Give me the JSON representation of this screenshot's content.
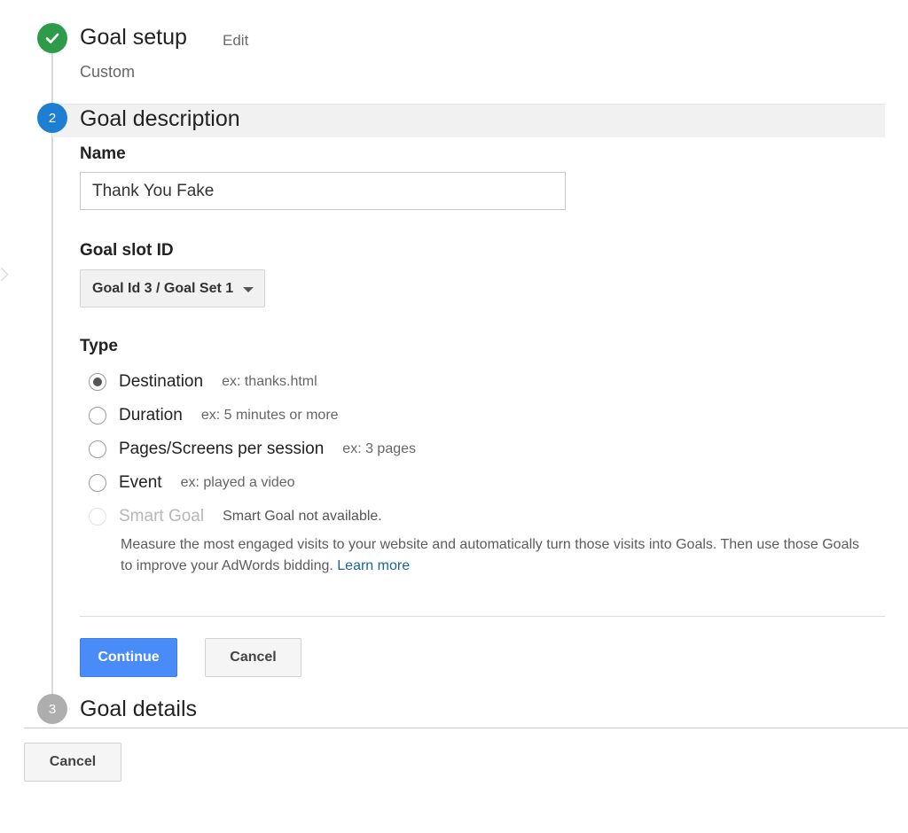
{
  "steps": {
    "setup": {
      "title": "Goal setup",
      "edit_label": "Edit",
      "summary": "Custom",
      "icon": "checkmark-icon"
    },
    "description": {
      "number": "2",
      "title": "Goal description"
    },
    "details": {
      "number": "3",
      "title": "Goal details"
    }
  },
  "form": {
    "name": {
      "label": "Name",
      "value": "Thank You Fake"
    },
    "slot": {
      "label": "Goal slot ID",
      "selected": "Goal Id 3 / Goal Set 1"
    },
    "type": {
      "label": "Type",
      "options": [
        {
          "label": "Destination",
          "example": "ex: thanks.html",
          "selected": true,
          "disabled": false
        },
        {
          "label": "Duration",
          "example": "ex: 5 minutes or more",
          "selected": false,
          "disabled": false
        },
        {
          "label": "Pages/Screens per session",
          "example": "ex: 3 pages",
          "selected": false,
          "disabled": false
        },
        {
          "label": "Event",
          "example": "ex: played a video",
          "selected": false,
          "disabled": false
        },
        {
          "label": "Smart Goal",
          "example": "Smart Goal not available.",
          "selected": false,
          "disabled": true
        }
      ],
      "smart_goal_description": "Measure the most engaged visits to your website and automatically turn those visits into Goals. Then use those Goals to improve your AdWords bidding.",
      "learn_more": "Learn more"
    }
  },
  "buttons": {
    "continue": "Continue",
    "cancel": "Cancel",
    "page_cancel": "Cancel"
  },
  "colors": {
    "complete": "#2e9b4a",
    "active": "#1d7ed2",
    "inactive": "#aeaeae",
    "primary_button": "#4a8cf7",
    "link": "#15659e"
  }
}
